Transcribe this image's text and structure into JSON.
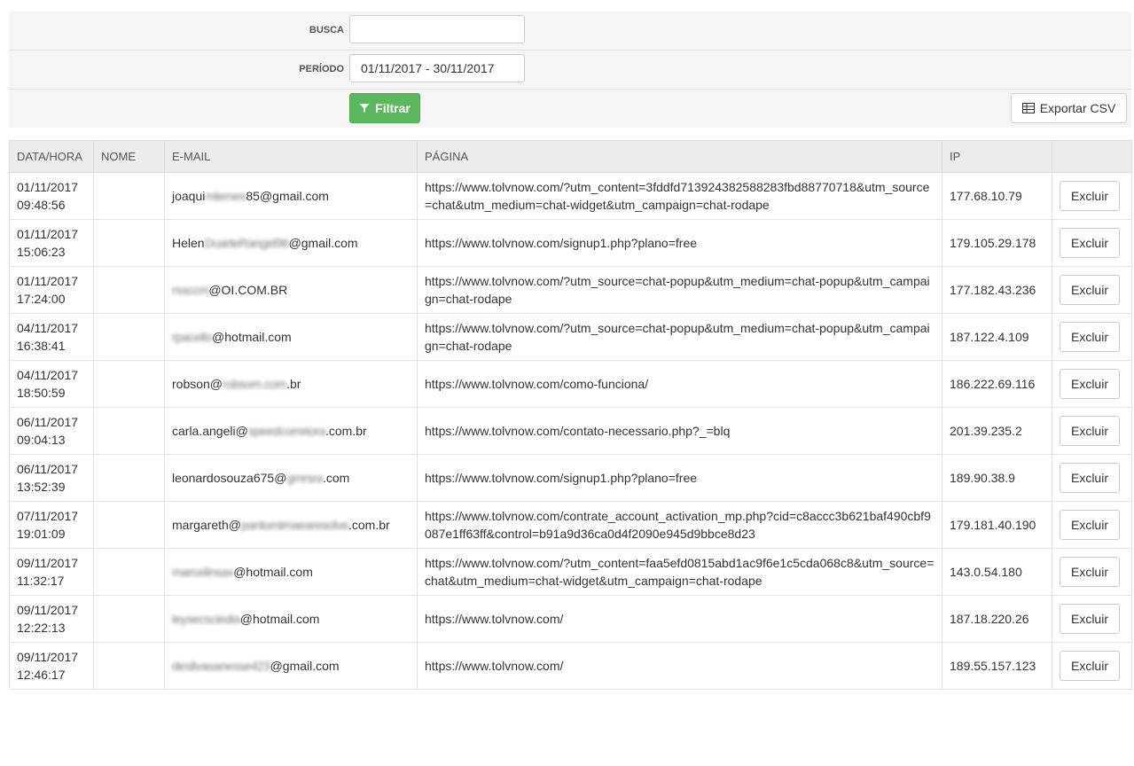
{
  "filters": {
    "search_label": "BUSCA",
    "search_value": "",
    "period_label": "PERÍODO",
    "period_value": "01/11/2017 - 30/11/2017",
    "filter_button": "Filtrar",
    "export_button": "Exportar CSV"
  },
  "table": {
    "headers": [
      "DATA/HORA",
      "NOME",
      "E-MAIL",
      "PÁGINA",
      "IP",
      ""
    ],
    "delete_label": "Excluir",
    "rows": [
      {
        "date": "01/11/2017",
        "time": "09:48:56",
        "name": "",
        "email_pre": "joaqui",
        "email_blur": "mlemes",
        "email_post": "85@gmail.com",
        "page": "https://www.tolvnow.com/?utm_content=3fddfd713924382588283fbd88770718&utm_source=chat&utm_medium=chat-widget&utm_campaign=chat-rodape",
        "ip": "177.68.10.79"
      },
      {
        "date": "01/11/2017",
        "time": "15:06:23",
        "name": "",
        "email_pre": "Helen",
        "email_blur": "DuarteRangel96",
        "email_post": "@gmail.com",
        "page": "https://www.tolvnow.com/signup1.php?plano=free",
        "ip": "179.105.29.178"
      },
      {
        "date": "01/11/2017",
        "time": "17:24:00",
        "name": "",
        "email_pre": "",
        "email_blur": "rssccm",
        "email_post": "@OI.COM.BR",
        "page": "https://www.tolvnow.com/?utm_source=chat-popup&utm_medium=chat-popup&utm_campaign=chat-rodape",
        "ip": "177.182.43.236"
      },
      {
        "date": "04/11/2017",
        "time": "16:38:41",
        "name": "",
        "email_pre": "",
        "email_blur": "rpacello",
        "email_post": "@hotmail.com",
        "page": "https://www.tolvnow.com/?utm_source=chat-popup&utm_medium=chat-popup&utm_campaign=chat-rodape",
        "ip": "187.122.4.109"
      },
      {
        "date": "04/11/2017",
        "time": "18:50:59",
        "name": "",
        "email_pre": "robson@",
        "email_blur": "robsom.com",
        "email_post": ".br",
        "page": "https://www.tolvnow.com/como-funciona/",
        "ip": "186.222.69.116"
      },
      {
        "date": "06/11/2017",
        "time": "09:04:13",
        "name": "",
        "email_pre": "carla.angeli@",
        "email_blur": "speedcorretora",
        "email_post": ".com.br",
        "page": "https://www.tolvnow.com/contato-necessario.php?_=blq",
        "ip": "201.39.235.2"
      },
      {
        "date": "06/11/2017",
        "time": "13:52:39",
        "name": "",
        "email_pre": "leonardosouza675@",
        "email_blur": "gmrsra",
        "email_post": ".com",
        "page": "https://www.tolvnow.com/signup1.php?plano=free",
        "ip": "189.90.38.9"
      },
      {
        "date": "07/11/2017",
        "time": "19:01:09",
        "name": "",
        "email_pre": "margareth@",
        "email_blur": "pantomimaearesolve",
        "email_post": ".com.br",
        "page": "https://www.tolvnow.com/contrate_account_activation_mp.php?cid=c8accc3b621baf490cbf9087e1ff63ff&control=b91a9d36ca0d4f2090e945d9bbce8d23",
        "ip": "179.181.40.190"
      },
      {
        "date": "09/11/2017",
        "time": "11:32:17",
        "name": "",
        "email_pre": "",
        "email_blur": "marcelinsax",
        "email_post": "@hotmail.com",
        "page": "https://www.tolvnow.com/?utm_content=faa5efd0815abd1ac9f6e1c5cda068c8&utm_source=chat&utm_medium=chat-widget&utm_campaign=chat-rodape",
        "ip": "143.0.54.180"
      },
      {
        "date": "09/11/2017",
        "time": "12:22:13",
        "name": "",
        "email_pre": "",
        "email_blur": "leysecsciedia",
        "email_post": "@hotmail.com",
        "page": "https://www.tolvnow.com/",
        "ip": "187.18.220.26"
      },
      {
        "date": "09/11/2017",
        "time": "12:46:17",
        "name": "",
        "email_pre": "",
        "email_blur": "desilvasanesse423",
        "email_post": "@gmail.com",
        "page": "https://www.tolvnow.com/",
        "ip": "189.55.157.123"
      }
    ]
  }
}
